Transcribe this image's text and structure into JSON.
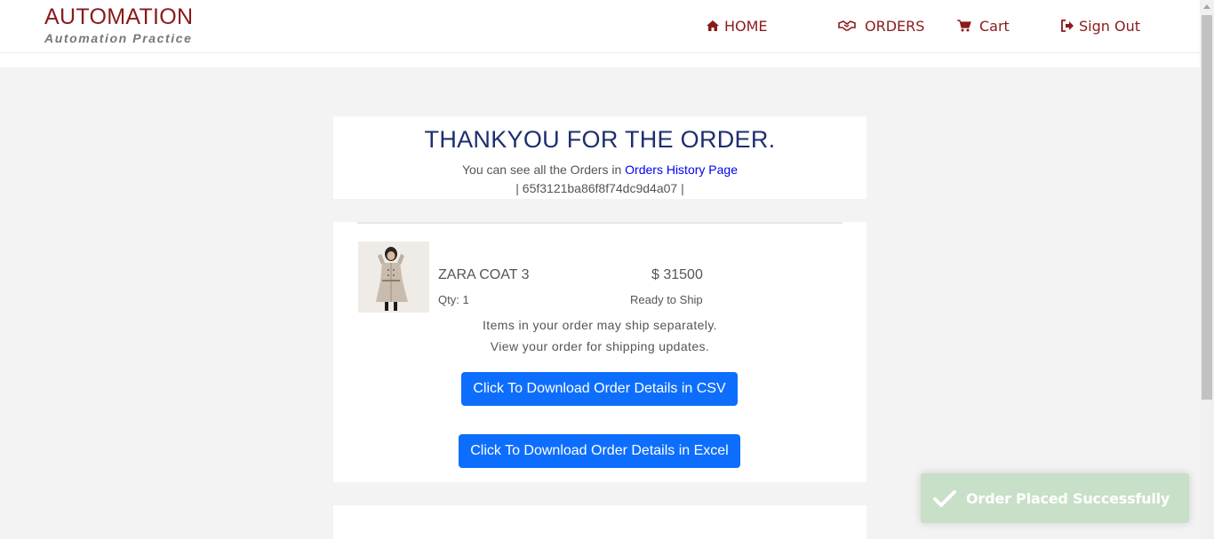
{
  "header": {
    "brand_title": "AUTOMATION",
    "brand_subtitle": "Automation Practice",
    "nav": {
      "home": {
        "label": "HOME",
        "icon": "home-icon"
      },
      "orders": {
        "label": "ORDERS",
        "icon": "handshake-icon"
      },
      "cart": {
        "label": "Cart",
        "icon": "cart-icon"
      },
      "signout": {
        "label": "Sign Out",
        "icon": "sign-out-icon"
      }
    }
  },
  "thanks": {
    "title": "THANKYOU FOR THE ORDER.",
    "line_prefix": "You can see all the Orders in ",
    "link_text": "Orders History Page",
    "order_id": "| 65f3121ba86f8f74dc9d4a07 |"
  },
  "order": {
    "product_name": "ZARA COAT 3",
    "price": "$ 31500",
    "qty": "Qty: 1",
    "status": "Ready to Ship",
    "ship_note_1": "Items in your order may ship separately.",
    "ship_note_2": "View your order for shipping updates.",
    "csv_button": "Click To Download Order Details in CSV",
    "excel_button": "Click To Download Order Details in Excel"
  },
  "toast": {
    "message": "Order Placed Successfully",
    "icon": "checkmark-icon"
  },
  "colors": {
    "brand": "#8b1a1a",
    "title": "#1e2f6e",
    "button": "#0d6efd",
    "toast": "#c8dfc8"
  }
}
